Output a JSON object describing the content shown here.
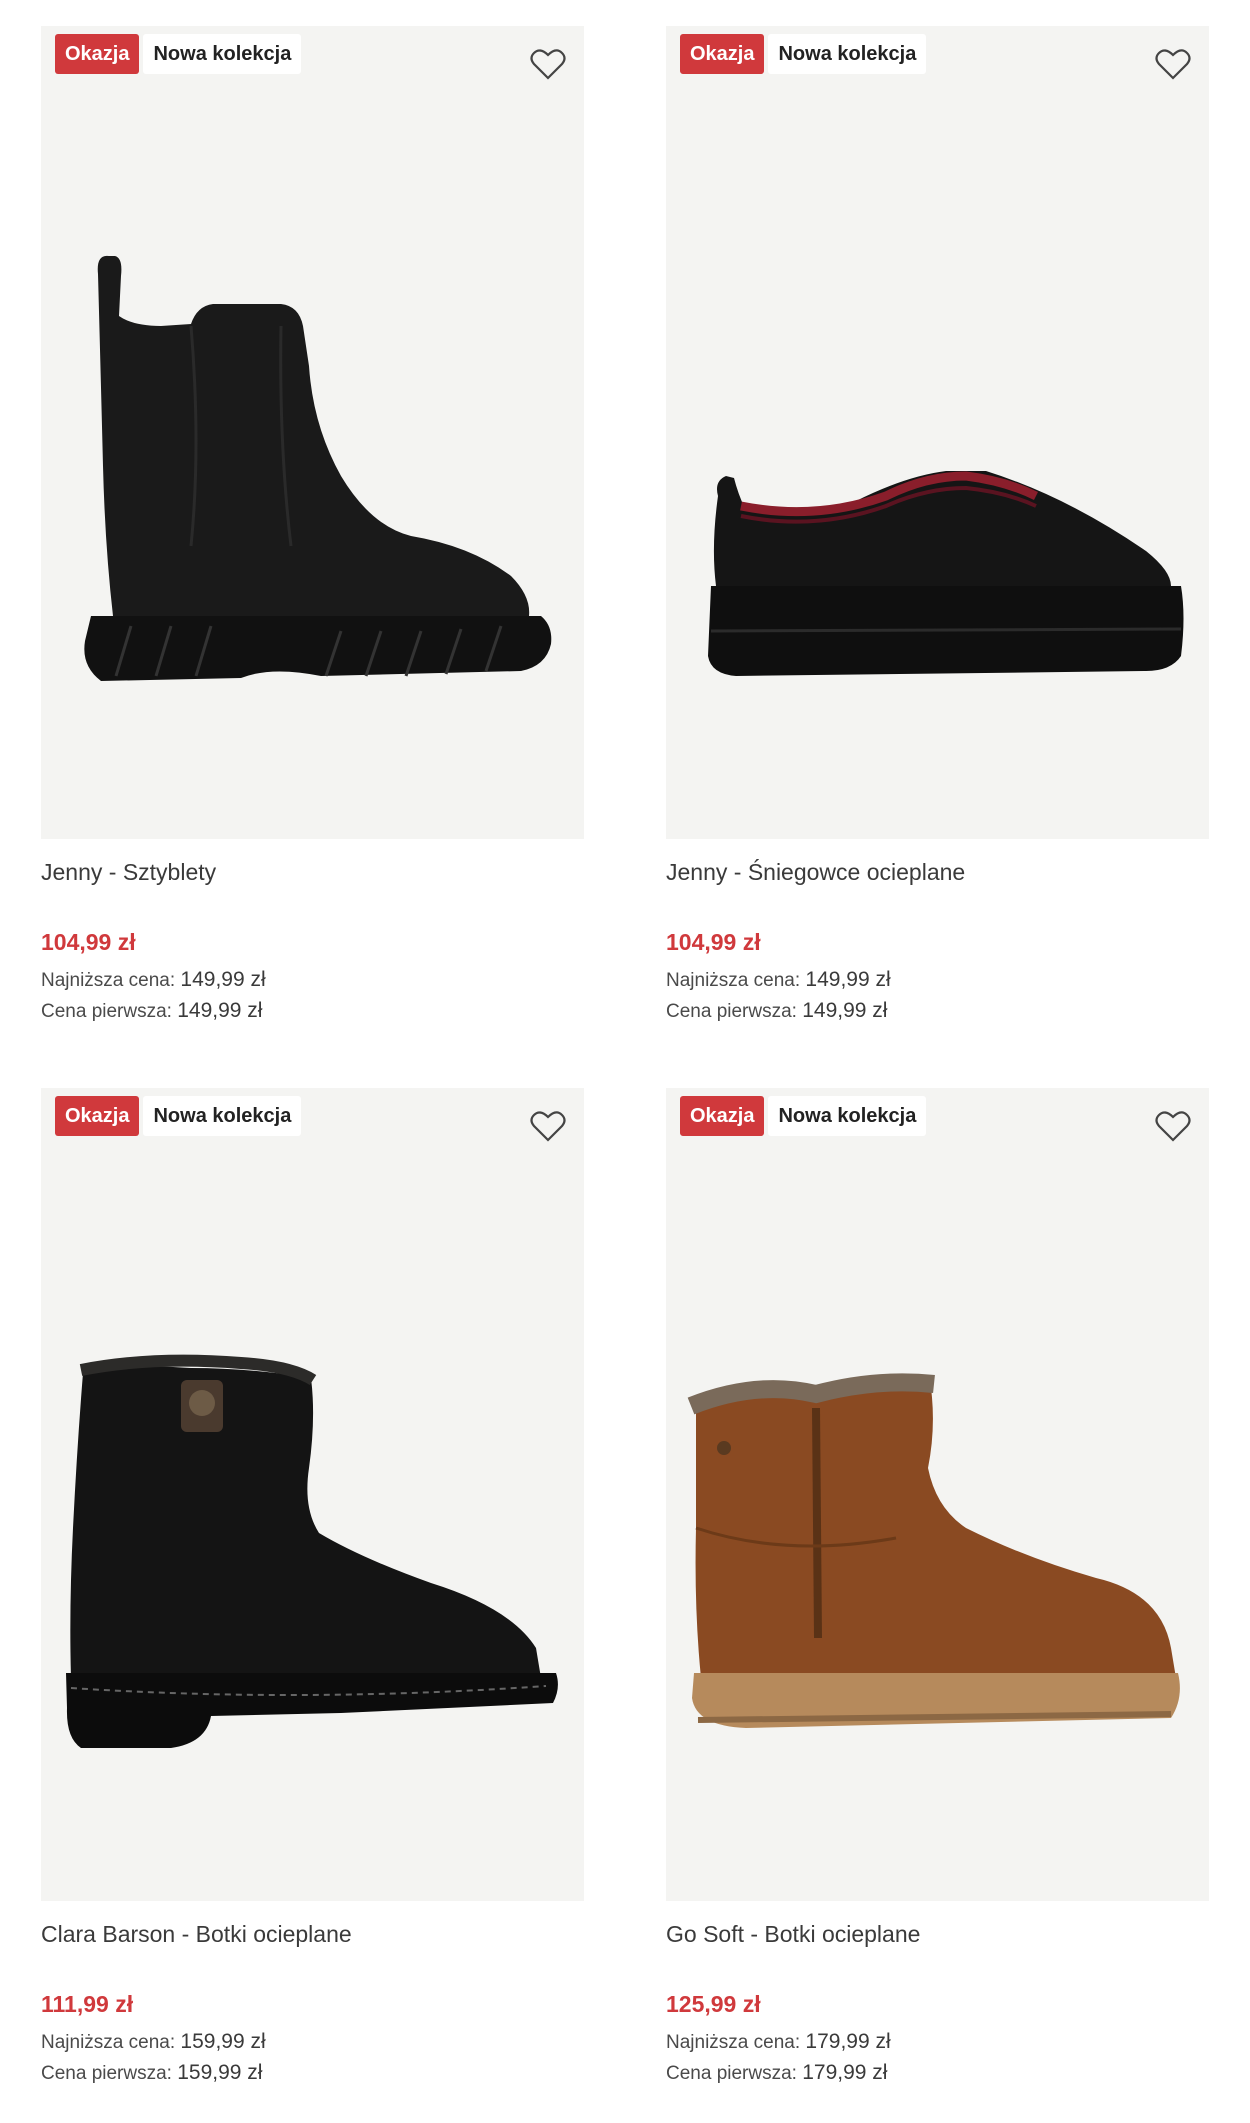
{
  "products": [
    {
      "badges": {
        "sale": "Okazja",
        "new": "Nowa kolekcja"
      },
      "title": "Jenny - Sztyblety",
      "price": "104,99 zł",
      "lowest_label": "Najniższa cena:",
      "lowest_value": "149,99 zł",
      "first_label": "Cena pierwsza:",
      "first_value": "149,99 zł"
    },
    {
      "badges": {
        "sale": "Okazja",
        "new": "Nowa kolekcja"
      },
      "title": "Jenny - Śniegowce ocieplane",
      "price": "104,99 zł",
      "lowest_label": "Najniższa cena:",
      "lowest_value": "149,99 zł",
      "first_label": "Cena pierwsza:",
      "first_value": "149,99 zł"
    },
    {
      "badges": {
        "sale": "Okazja",
        "new": "Nowa kolekcja"
      },
      "title": "Clara Barson - Botki ocieplane",
      "price": "111,99 zł",
      "lowest_label": "Najniższa cena:",
      "lowest_value": "159,99 zł",
      "first_label": "Cena pierwsza:",
      "first_value": "159,99 zł"
    },
    {
      "badges": {
        "sale": "Okazja",
        "new": "Nowa kolekcja"
      },
      "title": "Go Soft - Botki ocieplane",
      "price": "125,99 zł",
      "lowest_label": "Najniższa cena:",
      "lowest_value": "179,99 zł",
      "first_label": "Cena pierwsza:",
      "first_value": "179,99 zł"
    }
  ],
  "colors": {
    "sale": "#d0393c",
    "image_bg": "#f4f4f2",
    "price": "#d0393c"
  },
  "icons": {
    "wishlist": "heart-outline-icon"
  }
}
